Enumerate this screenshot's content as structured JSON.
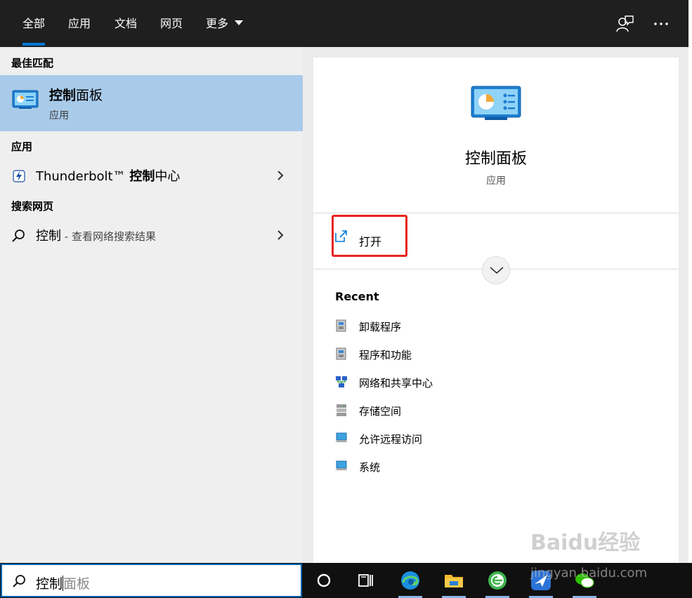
{
  "tabs": [
    {
      "label": "全部",
      "active": true
    },
    {
      "label": "应用",
      "active": false
    },
    {
      "label": "文档",
      "active": false
    },
    {
      "label": "网页",
      "active": false
    },
    {
      "label": "更多",
      "active": false
    }
  ],
  "top_icons": [
    "feedback-icon",
    "more-options-icon"
  ],
  "left": {
    "best_match_header": "最佳匹配",
    "best_match": {
      "title_bold": "控制",
      "title_rest": "面板",
      "subtitle": "应用",
      "icon": "control-panel-icon"
    },
    "apps_header": "应用",
    "apps": [
      {
        "name_pre": "Thunderbolt™ ",
        "name_bold": "控制",
        "name_post": "中心",
        "icon": "thunderbolt-icon"
      }
    ],
    "web_header": "搜索网页",
    "web": [
      {
        "query": "控制",
        "hint": " - 查看网络搜索结果",
        "icon": "search-icon"
      }
    ]
  },
  "preview": {
    "title": "控制面板",
    "subtitle": "应用",
    "actions": [
      {
        "label": "打开",
        "icon": "open-external-icon"
      }
    ],
    "recent_header": "Recent",
    "recent": [
      {
        "label": "卸载程序",
        "icon": "programs-icon"
      },
      {
        "label": "程序和功能",
        "icon": "programs-icon"
      },
      {
        "label": "网络和共享中心",
        "icon": "network-icon"
      },
      {
        "label": "存储空间",
        "icon": "storage-icon"
      },
      {
        "label": "允许远程访问",
        "icon": "computer-icon"
      },
      {
        "label": "系统",
        "icon": "computer-icon"
      }
    ]
  },
  "taskbar": {
    "search_typed": "控制",
    "search_suggestion": "面板",
    "apps": [
      "cortana-icon",
      "task-view-icon",
      "edge-icon",
      "file-explorer-icon",
      "browser-icon",
      "bird-app-icon",
      "wechat-icon"
    ]
  },
  "watermark": {
    "text": "Baidu经验",
    "sub": "jingyan.baidu.com"
  },
  "colors": {
    "accent": "#0078d7",
    "selected": "#a8cbea",
    "highlight_box": "#e8241d"
  }
}
